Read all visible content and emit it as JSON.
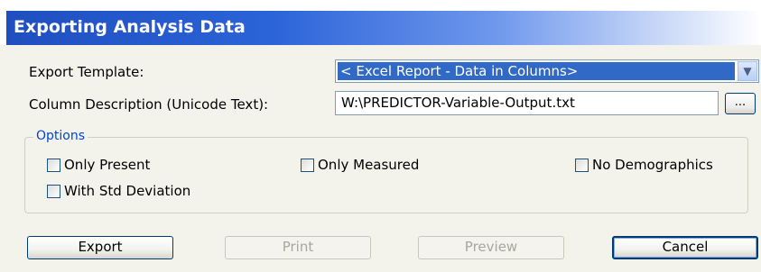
{
  "window": {
    "title": "Exporting Analysis Data"
  },
  "form": {
    "export_template_label": "Export Template:",
    "export_template_value": "< Excel Report - Data in Columns>",
    "column_description_label": "Column Description (Unicode Text):",
    "column_description_value": "W:\\PREDICTOR-Variable-Output.txt",
    "browse_label": "..."
  },
  "options": {
    "legend": "Options",
    "items": [
      {
        "label": "Only Present",
        "checked": false
      },
      {
        "label": "Only Measured",
        "checked": false
      },
      {
        "label": "No Demographics",
        "checked": false
      },
      {
        "label": "With Std Deviation",
        "checked": false
      }
    ]
  },
  "buttons": {
    "export": "Export",
    "print": "Print",
    "preview": "Preview",
    "cancel": "Cancel"
  },
  "colors": {
    "title_bar": "#2b63d8",
    "selection": "#3169c6",
    "legend_text": "#0046d5",
    "dialog_bg": "#f3f3ec"
  }
}
